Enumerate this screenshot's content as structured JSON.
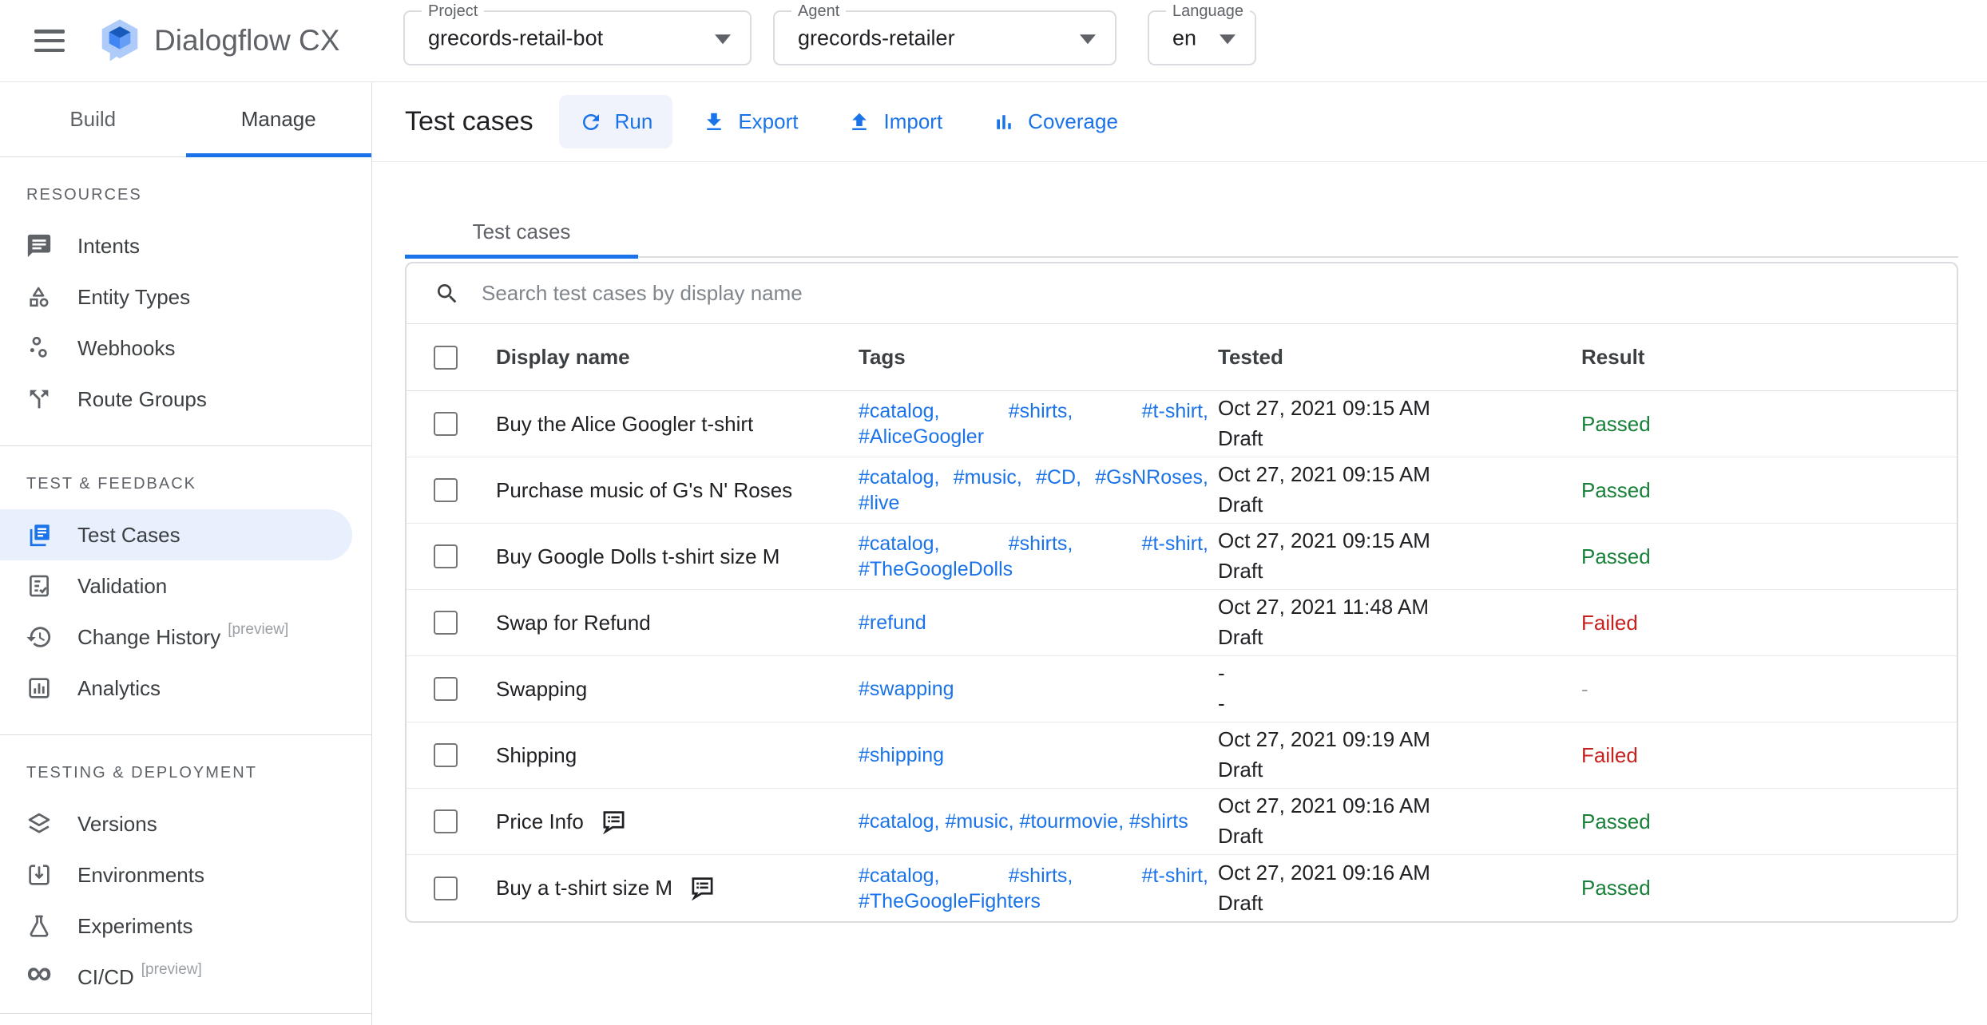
{
  "colors": {
    "accent_blue": "#1a73e8",
    "passed_green": "#188038",
    "failed_red": "#c5221f",
    "selected_item_bg": "#e8f0fe"
  },
  "app_bar": {
    "logo_title": "Dialogflow CX",
    "project": {
      "label": "Project",
      "value": "grecords-retail-bot"
    },
    "agent": {
      "label": "Agent",
      "value": "grecords-retailer"
    },
    "language": {
      "label": "Language",
      "value": "en"
    }
  },
  "sidebar": {
    "tabs": [
      {
        "label": "Build",
        "active": false
      },
      {
        "label": "Manage",
        "active": true
      }
    ],
    "sections": [
      {
        "title": "RESOURCES",
        "items": [
          {
            "label": "Intents",
            "icon": "chat-bubble"
          },
          {
            "label": "Entity Types",
            "icon": "shapes"
          },
          {
            "label": "Webhooks",
            "icon": "scatter-nodes"
          },
          {
            "label": "Route Groups",
            "icon": "split-arrows"
          }
        ]
      },
      {
        "title": "TEST & FEEDBACK",
        "items": [
          {
            "label": "Test Cases",
            "icon": "stacked-pages",
            "active": true
          },
          {
            "label": "Validation",
            "icon": "checklist"
          },
          {
            "label": "Change History",
            "icon": "history-clock",
            "badge": "[preview]"
          },
          {
            "label": "Analytics",
            "icon": "chart-box"
          }
        ]
      },
      {
        "title": "TESTING & DEPLOYMENT",
        "items": [
          {
            "label": "Versions",
            "icon": "layers"
          },
          {
            "label": "Environments",
            "icon": "inbox-arrow"
          },
          {
            "label": "Experiments",
            "icon": "flask"
          },
          {
            "label": "CI/CD",
            "icon": "infinity",
            "badge": "[preview]"
          }
        ]
      }
    ]
  },
  "main": {
    "title": "Test cases",
    "toolbar": [
      {
        "label": "Run",
        "icon": "refresh",
        "highlight": true
      },
      {
        "label": "Export",
        "icon": "download",
        "highlight": false
      },
      {
        "label": "Import",
        "icon": "upload",
        "highlight": false
      },
      {
        "label": "Coverage",
        "icon": "bar-chart",
        "highlight": false
      }
    ],
    "tab_label": "Test cases",
    "search_placeholder": "Search test cases by display name",
    "table": {
      "columns": [
        "Display name",
        "Tags",
        "Tested",
        "Result"
      ],
      "rows": [
        {
          "name": "Buy the Alice Googler t-shirt",
          "note": false,
          "tags": [
            "#catalog",
            "#shirts",
            "#t-shirt",
            "#AliceGoogler"
          ],
          "tested": [
            "Oct 27, 2021 09:15 AM",
            "Draft"
          ],
          "result": "Passed"
        },
        {
          "name": "Purchase music of G's N' Roses",
          "note": false,
          "tags": [
            "#catalog",
            "#music",
            "#CD",
            "#GsNRoses",
            "#live"
          ],
          "tested": [
            "Oct 27, 2021 09:15 AM",
            "Draft"
          ],
          "result": "Passed"
        },
        {
          "name": "Buy Google Dolls t-shirt size M",
          "note": false,
          "tags": [
            "#catalog",
            "#shirts",
            "#t-shirt",
            "#TheGoogleDolls"
          ],
          "tested": [
            "Oct 27, 2021 09:15 AM",
            "Draft"
          ],
          "result": "Passed"
        },
        {
          "name": "Swap for Refund",
          "note": false,
          "tags": [
            "#refund"
          ],
          "tested": [
            "Oct 27, 2021 11:48 AM",
            "Draft"
          ],
          "result": "Failed"
        },
        {
          "name": "Swapping",
          "note": false,
          "tags": [
            "#swapping"
          ],
          "tested": [
            "-",
            "-"
          ],
          "result": "-"
        },
        {
          "name": "Shipping",
          "note": false,
          "tags": [
            "#shipping"
          ],
          "tested": [
            "Oct 27, 2021 09:19 AM",
            "Draft"
          ],
          "result": "Failed"
        },
        {
          "name": "Price Info",
          "note": true,
          "tags": [
            "#catalog",
            "#music",
            "#tourmovie",
            "#shirts"
          ],
          "tested": [
            "Oct 27, 2021 09:16 AM",
            "Draft"
          ],
          "result": "Passed"
        },
        {
          "name": "Buy a t-shirt size M",
          "note": true,
          "tags": [
            "#catalog",
            "#shirts",
            "#t-shirt",
            "#TheGoogleFighters"
          ],
          "tested": [
            "Oct 27, 2021 09:16 AM",
            "Draft"
          ],
          "result": "Passed"
        }
      ]
    }
  }
}
